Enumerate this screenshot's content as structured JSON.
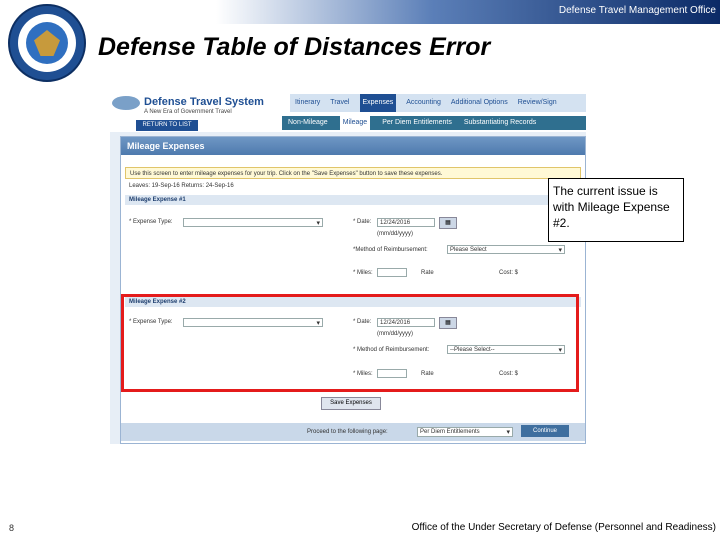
{
  "slide": {
    "office": "Defense Travel Management Office",
    "title": "Defense Table of Distances Error",
    "callout": "The current issue is with Mileage Expense #2.",
    "page_number": "8",
    "footer": "Office of the Under Secretary of Defense (Personnel and Readiness)"
  },
  "app": {
    "logo_title": "Defense Travel System",
    "logo_subtitle": "A New Era of Government Travel",
    "return_button": "RETURN TO LIST",
    "main_tabs": [
      {
        "label": "Itinerary"
      },
      {
        "label": "Travel"
      },
      {
        "label": "Expenses",
        "active": true
      },
      {
        "label": "Accounting"
      },
      {
        "label": "Additional Options"
      },
      {
        "label": "Review/Sign"
      }
    ],
    "sub_tabs": [
      {
        "label": "Non-Mileage"
      },
      {
        "label": "Mileage",
        "active": true
      },
      {
        "label": "Per Diem Entitlements"
      },
      {
        "label": "Substantiating Records"
      }
    ],
    "panel_title": "Mileage Expenses",
    "notice": "Use this screen to enter mileage expenses for your trip. Click on the \"Save Expenses\" button to save these expenses.",
    "trip_dates": "Leaves: 19-Sep-16   Returns: 24-Sep-16",
    "expense1": {
      "header": "Mileage Expense #1",
      "expense_type_label": "* Expense Type:",
      "date_label": "* Date:",
      "date_value": "12/24/2016",
      "date_format": "(mm/dd/yyyy)",
      "method_label": "*Method of Reimbursement:",
      "method_value": "Please Select",
      "miles_label": "* Miles:",
      "rate_label": "Rate",
      "cost_label": "Cost: $"
    },
    "expense2": {
      "header": "Mileage Expense #2",
      "expense_type_label": "* Expense Type:",
      "date_label": "* Date:",
      "date_value": "12/24/2016",
      "date_format": "(mm/dd/yyyy)",
      "method_label": "* Method of Reimbursement:",
      "method_value": "--Please Select--",
      "miles_label": "* Miles:",
      "rate_label": "Rate",
      "cost_label": "Cost: $"
    },
    "save_button": "Save Expenses",
    "proceed_label": "Proceed to the following page:",
    "proceed_value": "Per Diem Entitlements",
    "continue_button": "Continue"
  },
  "colors": {
    "highlight": "#e41b1b",
    "brand": "#1f4f93"
  }
}
